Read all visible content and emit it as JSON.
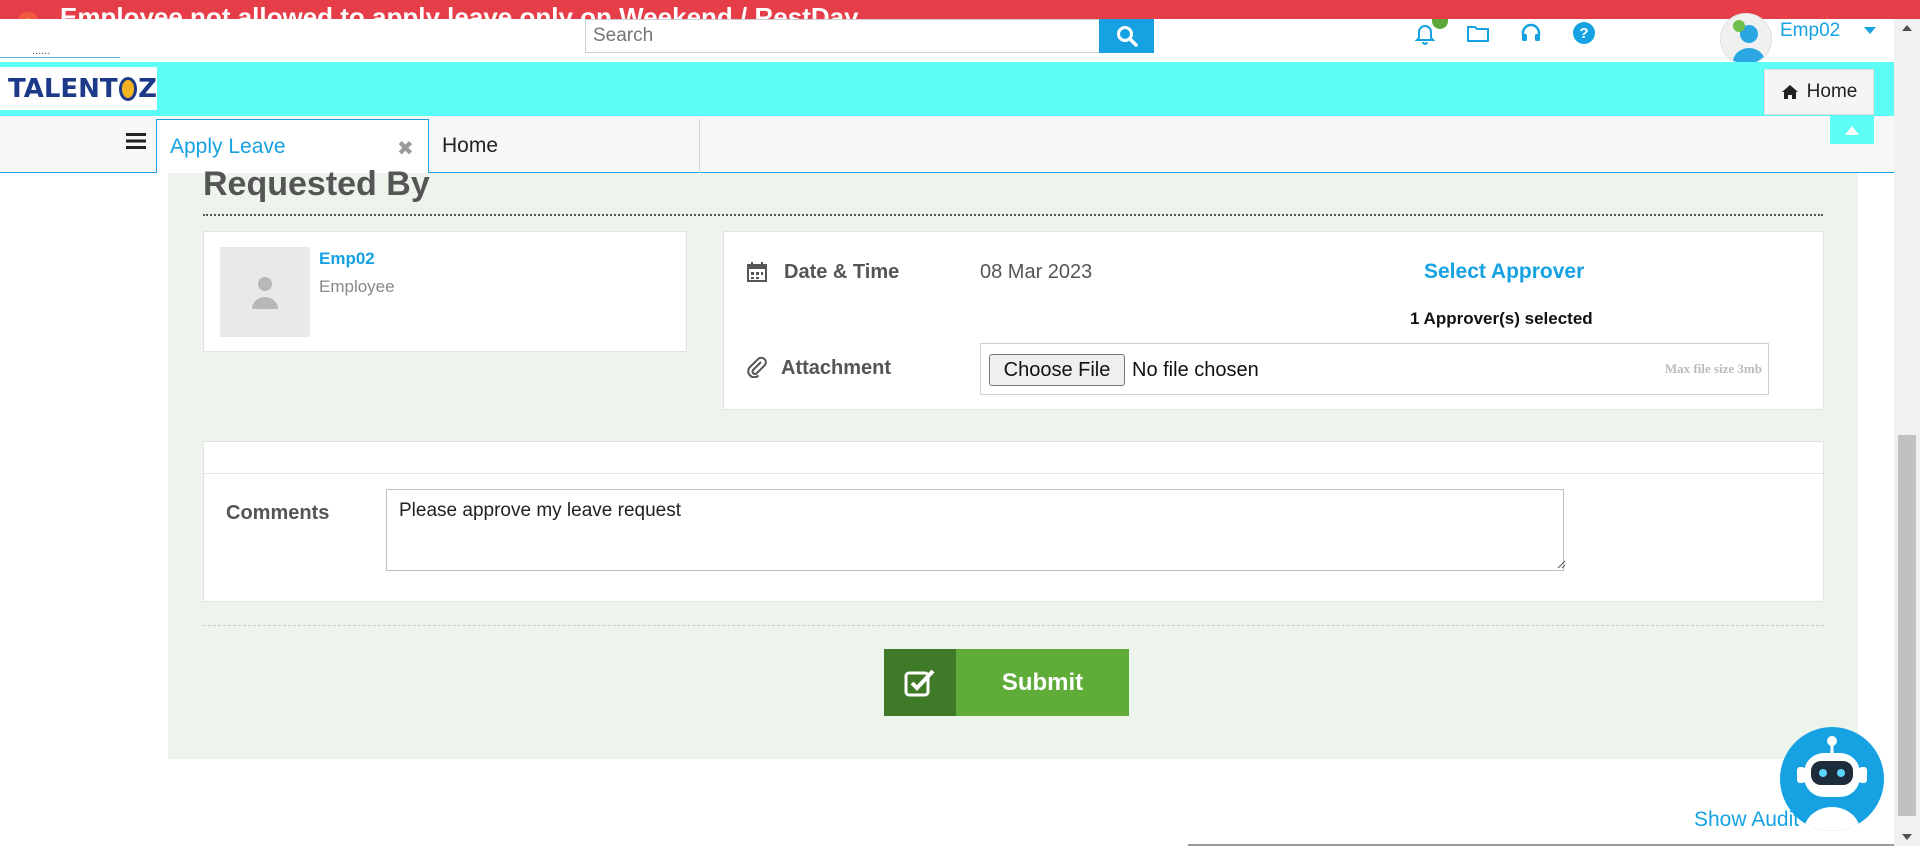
{
  "alert": {
    "text": "Employee not allowed to apply leave only on Weekend / RestDay"
  },
  "header": {
    "small_label": "......",
    "search_placeholder": "Search",
    "user_name": "Emp02",
    "icons": [
      "bell-icon",
      "folder-icon",
      "headset-icon",
      "help-icon"
    ]
  },
  "brand": {
    "logo_left": "TALENT",
    "logo_right": "Z",
    "home_label": "Home"
  },
  "tabs": {
    "active_label": "Apply Leave",
    "close_glyph": "✖",
    "second_label": "Home"
  },
  "form": {
    "section_title": "Requested By",
    "employee": {
      "name": "Emp02",
      "role": "Employee"
    },
    "date_label": "Date & Time",
    "date_value": "08 Mar 2023",
    "select_approver_label": "Select Approver",
    "approver_count_text": "1 Approver(s) selected",
    "attachment_label": "Attachment",
    "choose_file_label": "Choose File",
    "no_file_text": "No file chosen",
    "max_size_text": "Max file size 3mb",
    "comments_label": "Comments",
    "comments_value": "Please approve my leave request",
    "submit_label": "Submit"
  },
  "footer": {
    "show_audit_label": "Show Audit"
  },
  "colors": {
    "accent": "#16a2e2",
    "alert": "#e53e48",
    "cyan_bar": "#5cfff6",
    "panel": "#edf4ec",
    "submit": "#5fac39",
    "submit_dark": "#3f7a28"
  }
}
